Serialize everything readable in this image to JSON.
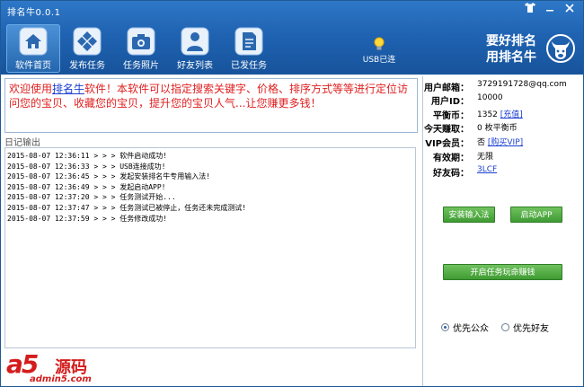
{
  "window": {
    "title": "排名牛0.0.1",
    "controls": [
      "shirt-icon",
      "minimize-icon",
      "close-icon"
    ]
  },
  "nav": {
    "items": [
      {
        "label": "软件首页",
        "icon": "home-icon",
        "active": true
      },
      {
        "label": "发布任务",
        "icon": "diamond-grid-icon",
        "active": false
      },
      {
        "label": "任务照片",
        "icon": "camera-icon",
        "active": false
      },
      {
        "label": "好友列表",
        "icon": "person-icon",
        "active": false
      },
      {
        "label": "已发任务",
        "icon": "document-icon",
        "active": false
      }
    ]
  },
  "usb": {
    "label": "USB已连",
    "icon": "lightbulb-icon"
  },
  "slogan": {
    "line1": "要好排名",
    "line2": "用排名牛"
  },
  "welcome": {
    "prefix": "欢迎使用",
    "link": "排名牛",
    "body": "软件！本软件可以指定搜索关键字、价格、排序方式等等进行定位访问您的宝贝、收藏您的宝贝，提升您的宝贝人气...让您赚更多钱！"
  },
  "log": {
    "title": "日记输出",
    "lines": [
      "2015-08-07 12:36:11 > > > 软件启动成功!",
      "2015-08-07 12:36:33 > > > USB连接成功!",
      "2015-08-07 12:36:45 > > > 发起安装排名牛专用输入法!",
      "2015-08-07 12:36:49 > > > 发起启动APP!",
      "2015-08-07 12:37:20 > > > 任务测试开始...",
      "2015-08-07 12:37:47 > > > 任务测试已被停止，任务还未完成测试!",
      "2015-08-07 12:37:59 > > > 任务修改成功!"
    ]
  },
  "account": {
    "email_label": "用户邮箱：",
    "email": "3729191728@qq.com",
    "uid_label": "用户ID：",
    "uid": "10000",
    "coin_label": "平衡币：",
    "coin": "1352",
    "recharge": "[充值]",
    "today_label": "今天赚取：",
    "today": "0 枚平衡币",
    "vip_label": "VIP会员：",
    "vip": "否",
    "buy_vip": "[购买VIP]",
    "valid_label": "有效期：",
    "valid": "无限",
    "friend_label": "好友码：",
    "friend_code": "3LCF"
  },
  "actions": {
    "install_ime": "安装输入法",
    "launch_app": "启动APP",
    "start_task": "开启任务玩命赚钱"
  },
  "priority": {
    "options": [
      "优先公众",
      "优先好友"
    ],
    "selected": 0
  },
  "watermark": {
    "brand": "a5",
    "brand_cn": "源码",
    "url": "admin5.com"
  },
  "colors": {
    "header": "#1f63b2",
    "welcome_text": "#e02020",
    "button_green": "#4fa842"
  }
}
